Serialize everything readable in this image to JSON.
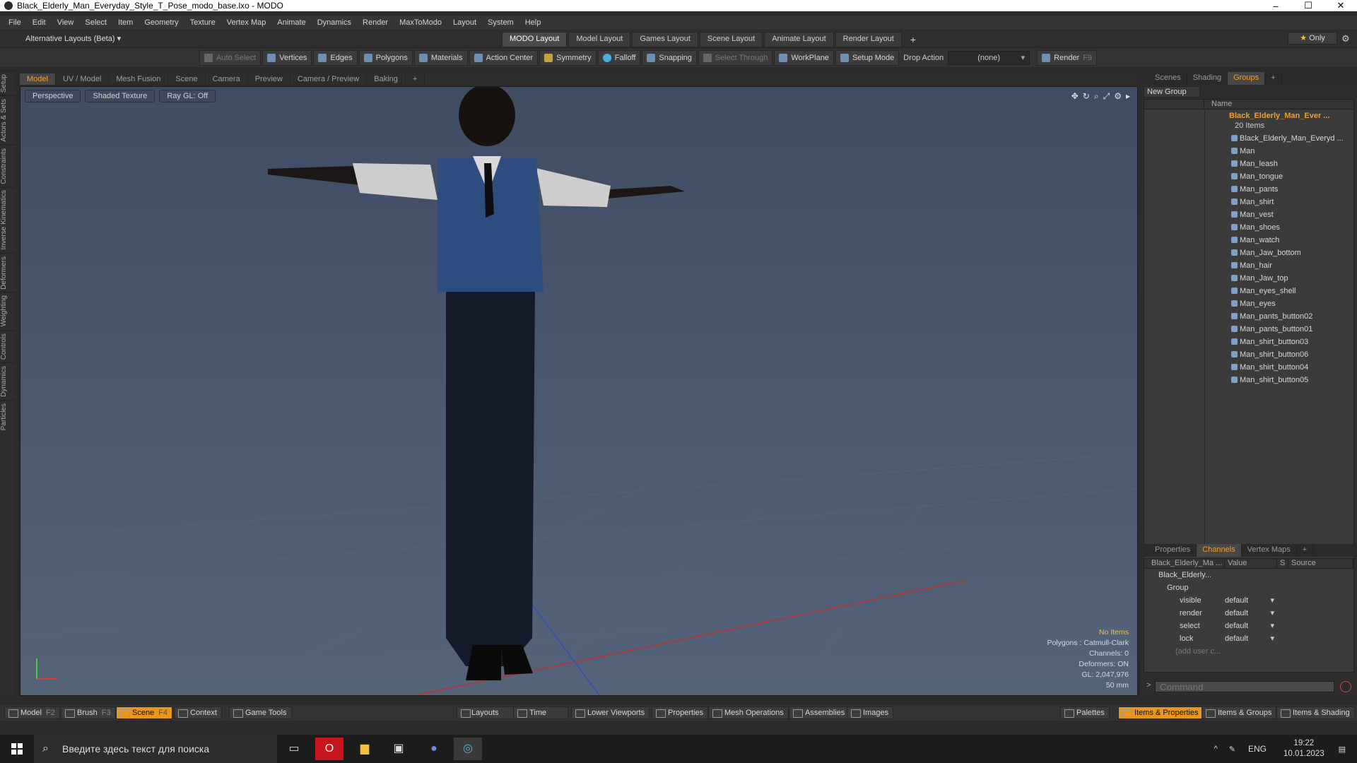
{
  "window": {
    "title": "Black_Elderly_Man_Everyday_Style_T_Pose_modo_base.lxo - MODO",
    "minimize": "–",
    "maximize": "☐",
    "close": "✕"
  },
  "menu": [
    "File",
    "Edit",
    "View",
    "Select",
    "Item",
    "Geometry",
    "Texture",
    "Vertex Map",
    "Animate",
    "Dynamics",
    "Render",
    "MaxToModo",
    "Layout",
    "System",
    "Help"
  ],
  "layout_bar": {
    "alt_layouts": "Alternative Layouts (Beta) ▾",
    "tabs": [
      "MODO Layout",
      "Model Layout",
      "Games Layout",
      "Scene Layout",
      "Animate Layout",
      "Render Layout"
    ],
    "add": "+",
    "only": "Only"
  },
  "toolbar": {
    "items": [
      "Auto Select",
      "Vertices",
      "Edges",
      "Polygons",
      "Materials",
      "Action Center",
      "Symmetry",
      "Falloff",
      "Snapping",
      "Select Through",
      "WorkPlane",
      "Setup Mode"
    ],
    "drop_action_label": "Drop Action",
    "drop_action_value": "(none)",
    "render_label": "Render",
    "render_hotkey": "F9"
  },
  "left_tabs": [
    "Setup",
    "Actors & Sets",
    "Constraints",
    "Inverse Kinematics",
    "Deformers",
    "Weighting",
    "Controls",
    "Dynamics",
    "Particles"
  ],
  "viewport_tabs": [
    "Model",
    "UV / Model",
    "Mesh Fusion",
    "Scene",
    "Camera",
    "Preview",
    "Camera / Preview",
    "Baking",
    "+"
  ],
  "viewport": {
    "options": [
      "Perspective",
      "Shaded Texture",
      "Ray GL: Off"
    ],
    "stats": {
      "selection": "No Items",
      "polygons": "Polygons : Catmull-Clark",
      "channels": "Channels: 0",
      "deformers": "Deformers: ON",
      "gl": "GL: 2,047,976",
      "focal": "50 mm"
    }
  },
  "right_tabs": [
    "Scenes",
    "Shading",
    "Groups",
    "+"
  ],
  "groups": {
    "new_group": "New Group",
    "name_header": "Name",
    "group_name": "Black_Elderly_Man_Ever ...",
    "group_count": "20 Items",
    "items": [
      "Black_Elderly_Man_Everyd ...",
      "Man",
      "Man_leash",
      "Man_tongue",
      "Man_pants",
      "Man_shirt",
      "Man_vest",
      "Man_shoes",
      "Man_watch",
      "Man_Jaw_bottom",
      "Man_hair",
      "Man_Jaw_top",
      "Man_eyes_shell",
      "Man_eyes",
      "Man_pants_button02",
      "Man_pants_button01",
      "Man_shirt_button03",
      "Man_shirt_button06",
      "Man_shirt_button04",
      "Man_shirt_button05"
    ]
  },
  "channel_tabs": [
    "Properties",
    "Channels",
    "Vertex Maps",
    "+"
  ],
  "channels": {
    "headers": [
      "Black_Elderly_Ma ...",
      "Value",
      "S",
      "Source"
    ],
    "item": "Black_Elderly...",
    "group": "Group",
    "rows": [
      {
        "name": "visible",
        "value": "default"
      },
      {
        "name": "render",
        "value": "default"
      },
      {
        "name": "select",
        "value": "default"
      },
      {
        "name": "lock",
        "value": "default"
      }
    ],
    "add_user": "(add user c...",
    "command_placeholder": "Command"
  },
  "bottom_bar": {
    "left": [
      {
        "label": "Model",
        "hk": "F2"
      },
      {
        "label": "Brush",
        "hk": "F3"
      },
      {
        "label": "Scene",
        "hk": "F4"
      },
      {
        "label": "Context",
        "hk": ""
      },
      {
        "label": "Game Tools",
        "hk": ""
      }
    ],
    "middle": [
      "Layouts",
      "Time",
      "Lower Viewports",
      "Properties",
      "Mesh Operations",
      "Assemblies",
      "Images"
    ],
    "right": [
      "Palettes",
      "Items & Properties",
      "Items & Groups",
      "Items & Shading"
    ]
  },
  "taskbar": {
    "search_placeholder": "Введите здесь текст для поиска",
    "lang": "ENG",
    "time": "19:22",
    "date": "10.01.2023"
  }
}
